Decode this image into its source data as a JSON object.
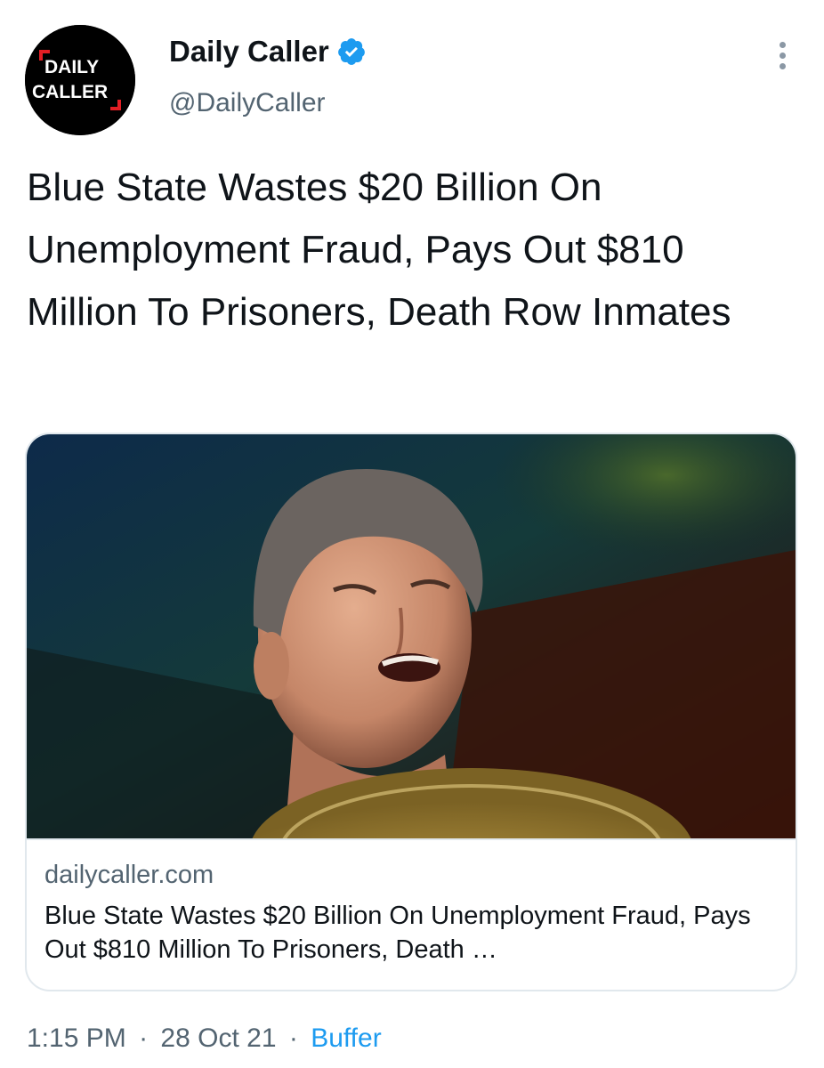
{
  "author": {
    "display_name": "Daily Caller",
    "handle": "@DailyCaller",
    "logo_text_line1": "DAILY",
    "logo_text_line2": "CALLER",
    "verified": true,
    "avatar_icon": "daily-caller-logo"
  },
  "tweet": {
    "text": "Blue State Wastes $20 Billion On Unemployment Fraud, Pays Out $810 Million To Prisoners, Death Row Inmates"
  },
  "card": {
    "domain": "dailycaller.com",
    "title": "Blue State Wastes $20 Billion On Unemployment Fraud, Pays Out $810 Million To Prisoners, Death …"
  },
  "meta": {
    "time": "1:15 PM",
    "date": "28 Oct 21",
    "separator": "·",
    "source": "Buffer"
  },
  "colors": {
    "text": "#0f1419",
    "secondary": "#536471",
    "link": "#1d9bf0",
    "verified": "#1d9bf0",
    "border": "#e1e8ed",
    "logo_accent": "#e31e24"
  },
  "icons": {
    "verified": "verified-badge-icon",
    "more": "more-options-icon"
  }
}
